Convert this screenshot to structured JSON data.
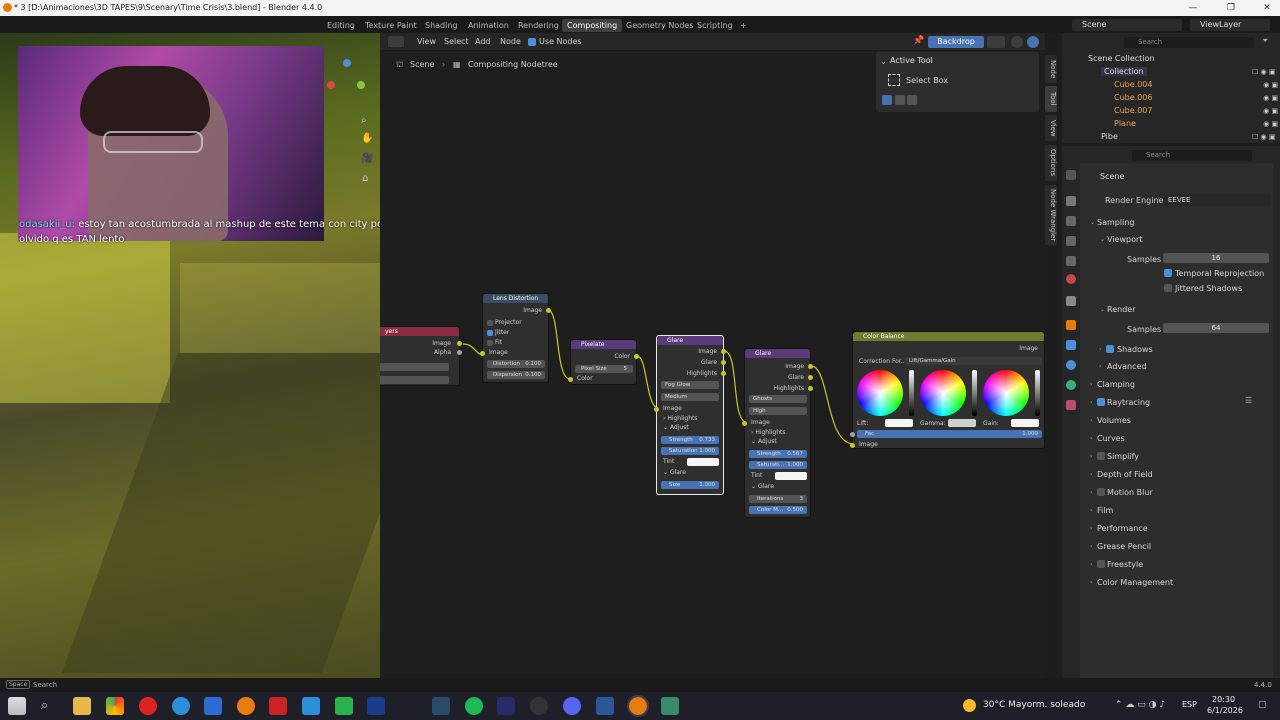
{
  "window": {
    "title": "* 3 [D:\\Animaciones\\3D TAPES\\9\\Scenary\\Time Crisis\\3.blend] - Blender 4.4.0",
    "version": "4.4.0"
  },
  "workspaces": [
    "Editing",
    "Texture Paint",
    "Shading",
    "Animation",
    "Rendering",
    "Compositing",
    "Geometry Nodes",
    "Scripting",
    "+"
  ],
  "active_workspace": "Compositing",
  "top_right": {
    "scene": "Scene",
    "view_layer": "ViewLayer"
  },
  "editor_menu": [
    "View",
    "Select",
    "Add",
    "Node"
  ],
  "use_nodes": "Use Nodes",
  "backdrop": "Backdrop",
  "breadcrumb": {
    "scene": "Scene",
    "tree": "Compositing Nodetree"
  },
  "active_tool": {
    "header": "Active Tool",
    "tool": "Select Box"
  },
  "side_tabs": [
    "Node",
    "Tool",
    "View",
    "Options",
    "Node Wrangler"
  ],
  "chat": {
    "user": "odasakii_u:",
    "message": "estoy tan acostumbrada al mashup de este tema con city pop q me olvido q es TAN lento"
  },
  "nodes": {
    "layers": {
      "title": "yers",
      "out1": "Image",
      "out2": "Alpha"
    },
    "lens": {
      "title": "Lens Distortion",
      "out": "Image",
      "projector": "Projector",
      "jitter": "Jitter",
      "fit": "Fit",
      "in": "Image",
      "distortion": "Distortion",
      "distortion_val": "0.100",
      "dispersion": "Dispersion",
      "dispersion_val": "0.100"
    },
    "pixelate": {
      "title": "Pixelate",
      "out": "Color",
      "size_label": "Pixel Size",
      "size": "5",
      "in": "Color"
    },
    "glare1": {
      "title": "Glare",
      "outs": [
        "Image",
        "Glare",
        "Highlights"
      ],
      "type": "Fog Glow",
      "quality": "Medium",
      "in": "Image",
      "highlights": "Highlights",
      "adjust": "Adjust",
      "strength": "Strength",
      "strength_val": "0.733",
      "saturation": "Saturation",
      "saturation_val": "1.000",
      "tint": "Tint",
      "glare": "Glare",
      "size": "Size",
      "size_val": "1.000"
    },
    "glare2": {
      "title": "Glare",
      "outs": [
        "Image",
        "Glare",
        "Highlights"
      ],
      "type": "Ghosts",
      "quality": "High",
      "in": "Image",
      "highlights": "Highlights",
      "adjust": "Adjust",
      "strength": "Strength",
      "strength_val": "0.567",
      "saturation": "Saturati...",
      "saturation_val": "1.000",
      "tint": "Tint",
      "glare": "Glare",
      "iterations": "Iterations",
      "iterations_val": "3",
      "colormod": "Color M...",
      "colormod_val": "0.500"
    },
    "colorbalance": {
      "title": "Color Balance",
      "out": "Image",
      "correction": "Correction For...",
      "mode": "Lift/Gamma/Gain",
      "lift": "Lift:",
      "gamma": "Gamma:",
      "gain": "Gain:",
      "fac": "Fac",
      "fac_val": "1.000",
      "in": "Image"
    }
  },
  "outliner": {
    "search": "Search",
    "items": [
      {
        "label": "Scene Collection"
      },
      {
        "label": "Collection"
      },
      {
        "label": "Cube.004"
      },
      {
        "label": "Cube.006"
      },
      {
        "label": "Cube.007"
      },
      {
        "label": "Plane"
      },
      {
        "label": "Pibe"
      }
    ]
  },
  "properties": {
    "search": "Search",
    "scene": "Scene",
    "render_engine_label": "Render Engine",
    "render_engine": "EEVEE",
    "sampling": "Sampling",
    "viewport": "Viewport",
    "samples": "Samples",
    "viewport_samples": "16",
    "temporal": "Temporal Reprojection",
    "jittered": "Jittered Shadows",
    "render": "Render",
    "render_samples": "64",
    "shadows": "Shadows",
    "advanced": "Advanced",
    "sections": [
      "Clamping",
      "Raytracing",
      "Volumes",
      "Curves",
      "Simplify",
      "Depth of Field",
      "Motion Blur",
      "Film",
      "Performance",
      "Grease Pencil",
      "Freestyle",
      "Color Management"
    ]
  },
  "statusbar": {
    "key": "Space",
    "hint": "Search"
  },
  "taskbar": {
    "weather": "30°C  Mayorm. soleado",
    "lang": "ESP",
    "time": "20:30",
    "date": "6/1/2026"
  },
  "colors": {
    "accent": "#4772b3",
    "socket": "#c7c729",
    "colorbalance_header": "#6b7d2e",
    "pixelate_header": "#5b3a7a",
    "glare_header": "#5b3a7a"
  }
}
